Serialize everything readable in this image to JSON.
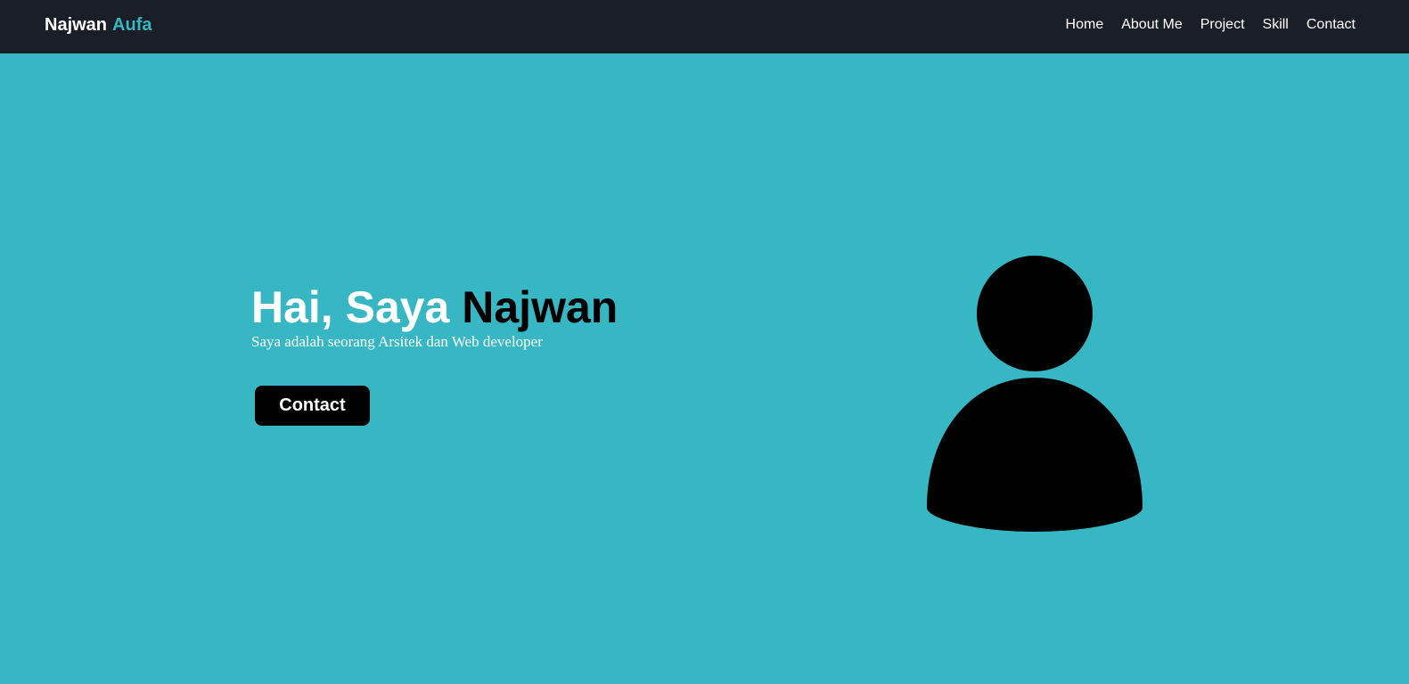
{
  "navbar": {
    "brand_first": "Najwan",
    "brand_last": "Aufa",
    "links": [
      "Home",
      "About Me",
      "Project",
      "Skill",
      "Contact"
    ]
  },
  "hero": {
    "title_prefix": "Hai, Saya ",
    "title_name": "Najwan",
    "subtitle": "Saya adalah seorang Arsitek dan Web developer",
    "button_label": "Contact",
    "avatar_icon": "user-icon"
  },
  "colors": {
    "navbar_bg": "#1a1e26",
    "page_bg": "#37b6c4",
    "accent": "#37b6c4",
    "button_bg": "#000000"
  }
}
